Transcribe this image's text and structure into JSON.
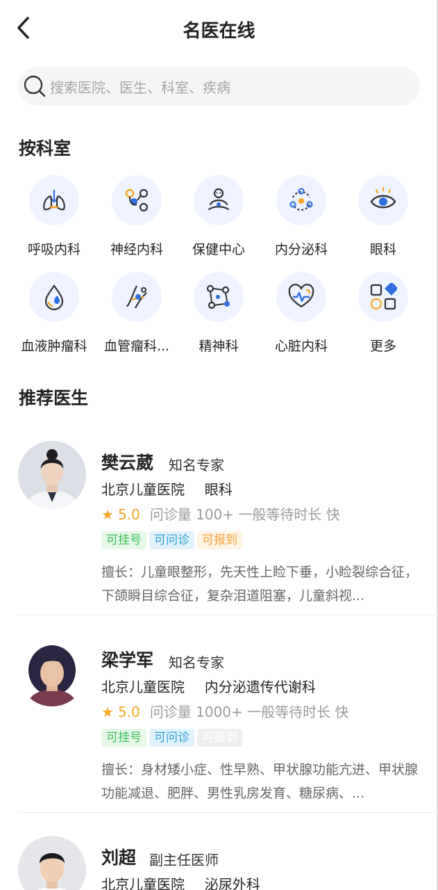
{
  "header": {
    "title": "名医在线",
    "back_icon": "chevron-left-icon"
  },
  "search": {
    "placeholder": "搜索医院、医生、科室、疾病",
    "icon": "search-icon"
  },
  "departments": {
    "title": "按科室",
    "items": [
      {
        "label": "呼吸内科",
        "icon": "lungs-icon"
      },
      {
        "label": "神经内科",
        "icon": "neuron-icon"
      },
      {
        "label": "保健中心",
        "icon": "meditation-icon"
      },
      {
        "label": "内分泌科",
        "icon": "endocrine-cycle-icon"
      },
      {
        "label": "眼科",
        "icon": "eye-icon"
      },
      {
        "label": "血液肿瘤科",
        "icon": "blood-drop-icon"
      },
      {
        "label": "血管瘤科...",
        "icon": "vessel-icon"
      },
      {
        "label": "精神科",
        "icon": "network-nodes-icon"
      },
      {
        "label": "心脏内科",
        "icon": "heart-pulse-icon"
      },
      {
        "label": "更多",
        "icon": "grid-more-icon"
      }
    ]
  },
  "recommended": {
    "title": "推荐医生",
    "doctors": [
      {
        "name": "樊云葳",
        "title": "知名专家",
        "hospital": "北京儿童医院",
        "department": "眼科",
        "rating": "5.0",
        "meta": "问诊量 100+ 一般等待时长 快",
        "tags": [
          "可挂号",
          "可问诊",
          "可报到"
        ],
        "expertise": "擅长：儿童眼整形，先天性上睑下垂，小睑裂综合征，下颌瞬目综合征，复杂泪道阻塞，儿童斜视..."
      },
      {
        "name": "梁学军",
        "title": "知名专家",
        "hospital": "北京儿童医院",
        "department": "内分泌遗传代谢科",
        "rating": "5.0",
        "meta": "问诊量 1000+ 一般等待时长 快",
        "tags": [
          "可挂号",
          "可问诊",
          "可报到"
        ],
        "expertise": "擅长：身材矮小症、性早熟、甲状腺功能亢进、甲状腺功能减退、肥胖、男性乳房发育、糖尿病、..."
      },
      {
        "name": "刘超",
        "title": "副主任医师",
        "hospital": "北京儿童医院",
        "department": "泌尿外科"
      }
    ]
  },
  "colors": {
    "accent_star": "#f5a623",
    "icon_blue": "#2f6fe0",
    "icon_orange": "#f5a623",
    "circle_bg": "#eef3ff"
  }
}
